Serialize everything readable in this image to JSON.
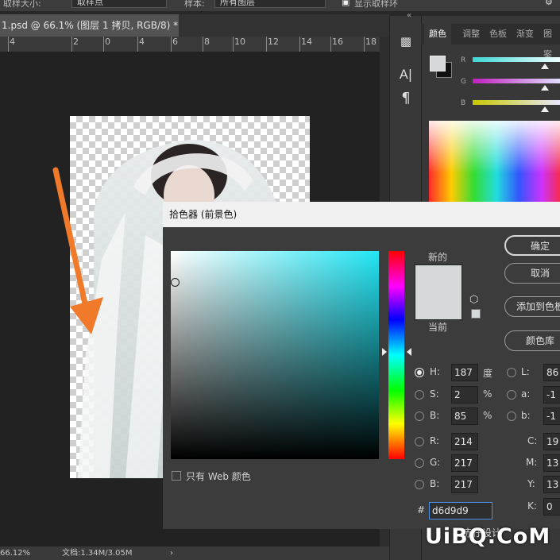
{
  "options_bar": {
    "field1_label": "取样大小:",
    "field1_value": "取样点",
    "field2_label": "样本:",
    "field2_value": "所有图层",
    "checkbox_label": "显示取样环"
  },
  "document": {
    "tab_title": "1.psd @ 66.1% (图层 1 拷贝, RGB/8) *",
    "close_glyph": "×"
  },
  "ruler": {
    "ticks": [
      "4",
      "2",
      "0",
      "2",
      "4",
      "6",
      "8",
      "10",
      "12",
      "14",
      "16",
      "18"
    ]
  },
  "status": {
    "zoom": "66.12%",
    "doc_info": "文档:1.34M/3.05M",
    "arrow_glyph": "›"
  },
  "right_panel": {
    "tabs": [
      "颜色",
      "调整",
      "色板",
      "渐变",
      "图案"
    ],
    "channel_labels": [
      "R",
      "G",
      "B"
    ],
    "collapse_glyph": "«",
    "tool_glyphs": [
      "A|",
      "¶"
    ]
  },
  "color_picker": {
    "title": "拾色器 (前景色)",
    "new_label": "新的",
    "current_label": "当前",
    "buttons": {
      "ok": "确定",
      "cancel": "取消",
      "add_swatch": "添加到色板",
      "color_libraries": "颜色库"
    },
    "hsb": {
      "h_label": "H:",
      "h_value": "187",
      "h_unit": "度",
      "s_label": "S:",
      "s_value": "2",
      "s_unit": "%",
      "b_label": "B:",
      "b_value": "85",
      "b_unit": "%"
    },
    "rgb": {
      "r_label": "R:",
      "r_value": "214",
      "g_label": "G:",
      "g_value": "217",
      "b_label": "B:",
      "b_value": "217"
    },
    "lab": {
      "l_label": "L:",
      "l_value": "86",
      "a_label": "a:",
      "a_value": "-1",
      "b_label": "b:",
      "b_value": "-1"
    },
    "cmyk": {
      "c_label": "C:",
      "c_value": "19",
      "m_label": "M:",
      "m_value": "13",
      "y_label": "Y:",
      "y_value": "13",
      "k_label": "K:",
      "k_value": "0"
    },
    "hex_label": "#",
    "hex_value": "d6d9d9",
    "web_only_label": "只有 Web 颜色",
    "new_color": "#d6d9d9",
    "current_color": "#d6d9d9",
    "field_hue_color": "#22e6f5"
  },
  "watermark": {
    "text": "UiBQ.CoM",
    "sub": "赤仔设计"
  },
  "colors": {
    "arrow": "#f07a2a",
    "dialog_bg": "#3c3c3c",
    "app_bg": "#282828"
  }
}
